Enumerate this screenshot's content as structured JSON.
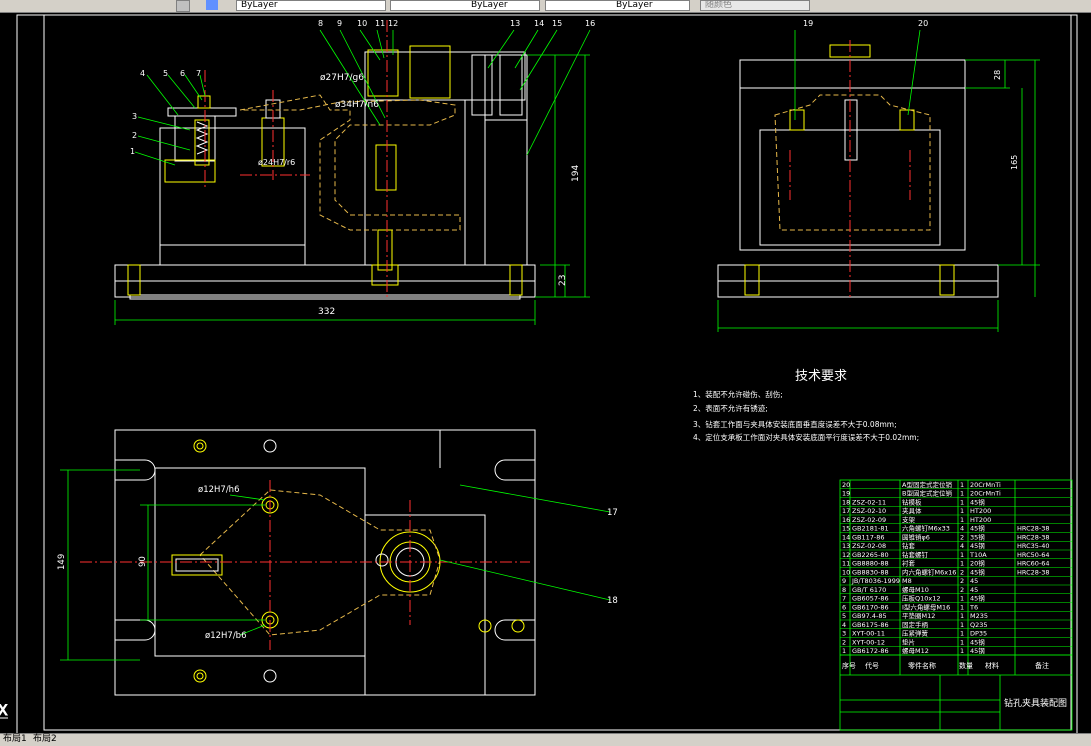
{
  "toolbar": {
    "layer_combo": "ByLayer",
    "linetype_combo": "ByLayer",
    "lineweight_combo": "ByLayer",
    "plotstyle_combo": "随颜色"
  },
  "tabs": {
    "layout1": "布局1",
    "layout2": "布局2"
  },
  "ucs_label": "X",
  "drawing": {
    "tech_title": "技术要求",
    "tech_notes": [
      "1、装配不允许碰伤、刮伤;",
      "2、表面不允许有锈迹;",
      "3、钻套工作面与夹具体安装底面垂直度误差不大于0.08mm;",
      "4、定位支承板工作面对夹具体安装底面平行度误差不大于0.02mm;"
    ],
    "dims": {
      "width_332": "332",
      "height_194": "194",
      "height_23": "23",
      "height_28": "28",
      "height_165": "165",
      "height_149": "149",
      "height_90": "90",
      "fit_27": "ø27H7/g6",
      "fit_34": "ø34H7/n6",
      "fit_24": "ø24H7/r6",
      "fit_12a": "ø12H7/h6",
      "fit_12b": "ø12H7/b6"
    },
    "balloons_top": [
      "8",
      "9",
      "10",
      "11",
      "12",
      "13",
      "14",
      "15",
      "16"
    ],
    "balloons_left": [
      "4",
      "5",
      "6",
      "7"
    ],
    "balloons_side": [
      "3",
      "2",
      "1"
    ],
    "balloons_right": [
      "19",
      "20"
    ],
    "balloons_plan": [
      "17",
      "18"
    ],
    "bom_title": "钻孔夹具装配图",
    "bom_headers": [
      "序号",
      "代号",
      "零件名称",
      "数量",
      "材料",
      "备注"
    ],
    "bom_rows": [
      {
        "no": "20",
        "code": "",
        "name": "A型固定式定位销",
        "qty": "1",
        "mat": "20CrMnTi",
        "note": ""
      },
      {
        "no": "19",
        "code": "",
        "name": "B型固定式定位销",
        "qty": "1",
        "mat": "20CrMnTi",
        "note": ""
      },
      {
        "no": "18",
        "code": "ZSZ-02-11",
        "name": "钻模板",
        "qty": "1",
        "mat": "45钢",
        "note": ""
      },
      {
        "no": "17",
        "code": "ZSZ-02-10",
        "name": "夹具体",
        "qty": "1",
        "mat": "HT200",
        "note": ""
      },
      {
        "no": "16",
        "code": "ZSZ-02-09",
        "name": "支架",
        "qty": "1",
        "mat": "HT200",
        "note": ""
      },
      {
        "no": "15",
        "code": "GB2181-81",
        "name": "六角螺钉M6x33",
        "qty": "4",
        "mat": "45钢",
        "note": "HRC28-38"
      },
      {
        "no": "14",
        "code": "GB117-86",
        "name": "圆锥销φ6",
        "qty": "2",
        "mat": "35钢",
        "note": "HRC28-38"
      },
      {
        "no": "13",
        "code": "ZSZ-02-08",
        "name": "钻套",
        "qty": "4",
        "mat": "45钢",
        "note": "HRC35-40"
      },
      {
        "no": "12",
        "code": "GB2265-80",
        "name": "钻套螺钉",
        "qty": "1",
        "mat": "T10A",
        "note": "HRC50-64"
      },
      {
        "no": "11",
        "code": "GB8880-88",
        "name": "衬套",
        "qty": "1",
        "mat": "20钢",
        "note": "HRC60-64"
      },
      {
        "no": "10",
        "code": "GB8830-88",
        "name": "内六角螺钉M6x16",
        "qty": "2",
        "mat": "45钢",
        "note": "HRC28-38"
      },
      {
        "no": "9",
        "code": "JB/T8036-1999 M8",
        "name": "",
        "qty": "2",
        "mat": "45",
        "note": ""
      },
      {
        "no": "8",
        "code": "GB/T 6170",
        "name": "螺母M10",
        "qty": "2",
        "mat": "45",
        "note": ""
      },
      {
        "no": "7",
        "code": "GB6057-86",
        "name": "压板Q10x12",
        "qty": "1",
        "mat": "45钢",
        "note": ""
      },
      {
        "no": "6",
        "code": "GB6170-86",
        "name": "I型六角螺母M16",
        "qty": "1",
        "mat": "T6",
        "note": ""
      },
      {
        "no": "5",
        "code": "GB97.4-85",
        "name": "平垫圈M12",
        "qty": "1",
        "mat": "M235",
        "note": ""
      },
      {
        "no": "4",
        "code": "GB6175-86",
        "name": "固定手柄",
        "qty": "1",
        "mat": "Q235",
        "note": ""
      },
      {
        "no": "3",
        "code": "XYT-00-11",
        "name": "压紧弹簧",
        "qty": "1",
        "mat": "DP35",
        "note": ""
      },
      {
        "no": "2",
        "code": "XYT-00-12",
        "name": "垫片",
        "qty": "1",
        "mat": "45钢",
        "note": ""
      },
      {
        "no": "1",
        "code": "GB6172-86",
        "name": "螺母M12",
        "qty": "1",
        "mat": "45钢",
        "note": ""
      }
    ]
  },
  "colors": {
    "bg": "#000000",
    "white": "#ffffff",
    "yellow": "#ffff00",
    "red": "#ff3030",
    "green": "#00ff00",
    "dashed_part": "#e6b84a",
    "title_bar": "#d4d0c8"
  }
}
